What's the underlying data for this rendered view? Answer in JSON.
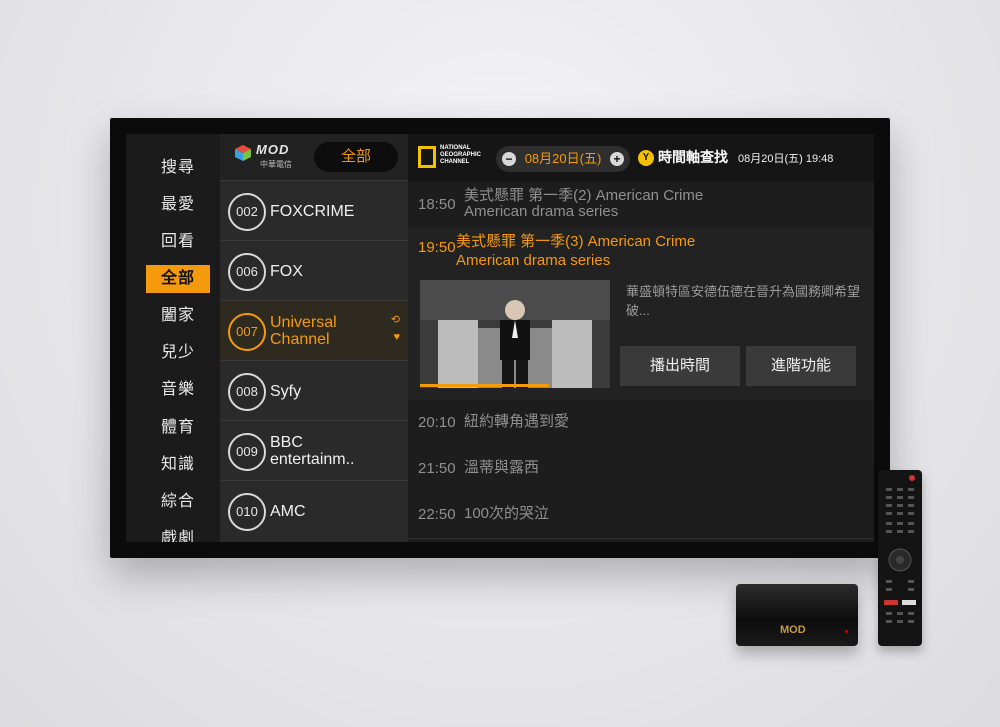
{
  "categories": {
    "items": [
      {
        "label": "搜尋"
      },
      {
        "label": "最愛"
      },
      {
        "label": "回看"
      },
      {
        "label": "全部"
      },
      {
        "label": "闔家"
      },
      {
        "label": "兒少"
      },
      {
        "label": "音樂"
      },
      {
        "label": "體育"
      },
      {
        "label": "知識"
      },
      {
        "label": "綜合"
      },
      {
        "label": "戲劇"
      }
    ],
    "active_label": "全部"
  },
  "channel_panel": {
    "brand": "MOD",
    "brand_sub": "中華電信",
    "filter_label": "全部",
    "channels": [
      {
        "number": "002",
        "name": "FOXCRIME"
      },
      {
        "number": "006",
        "name": "FOX"
      },
      {
        "number": "007",
        "name": "Universal Channel"
      },
      {
        "number": "008",
        "name": "Syfy"
      },
      {
        "number": "009",
        "name": "BBC entertainm.."
      },
      {
        "number": "010",
        "name": "AMC"
      }
    ]
  },
  "program_panel": {
    "channel_logo_text": "NATIONAL GEOGRAPHIC CHANNEL",
    "date_prev": "−",
    "date": "08月20日(五)",
    "date_next": "+",
    "timeline_key": "Y",
    "timeline_label": "時間軸查找",
    "current_datetime": "08月20日(五) 19:48",
    "programs": [
      {
        "time": "18:50",
        "title": "美式懸罪 第一季(2) American Crime American drama series"
      },
      {
        "time": "19:50",
        "title": "美式懸罪 第一季(3) American Crime American drama series"
      },
      {
        "time": "20:10",
        "title": "紐約轉角遇到愛"
      },
      {
        "time": "21:50",
        "title": "溫蒂與露西"
      },
      {
        "time": "22:50",
        "title": "100次的哭泣"
      }
    ],
    "active_description": "華盛頓特區安德伍德在晉升為國務卿希望破...",
    "play_time_button": "播出時間",
    "advanced_button": "進階功能",
    "progress": 0.68
  },
  "devices": {
    "settop_label": "MOD"
  }
}
